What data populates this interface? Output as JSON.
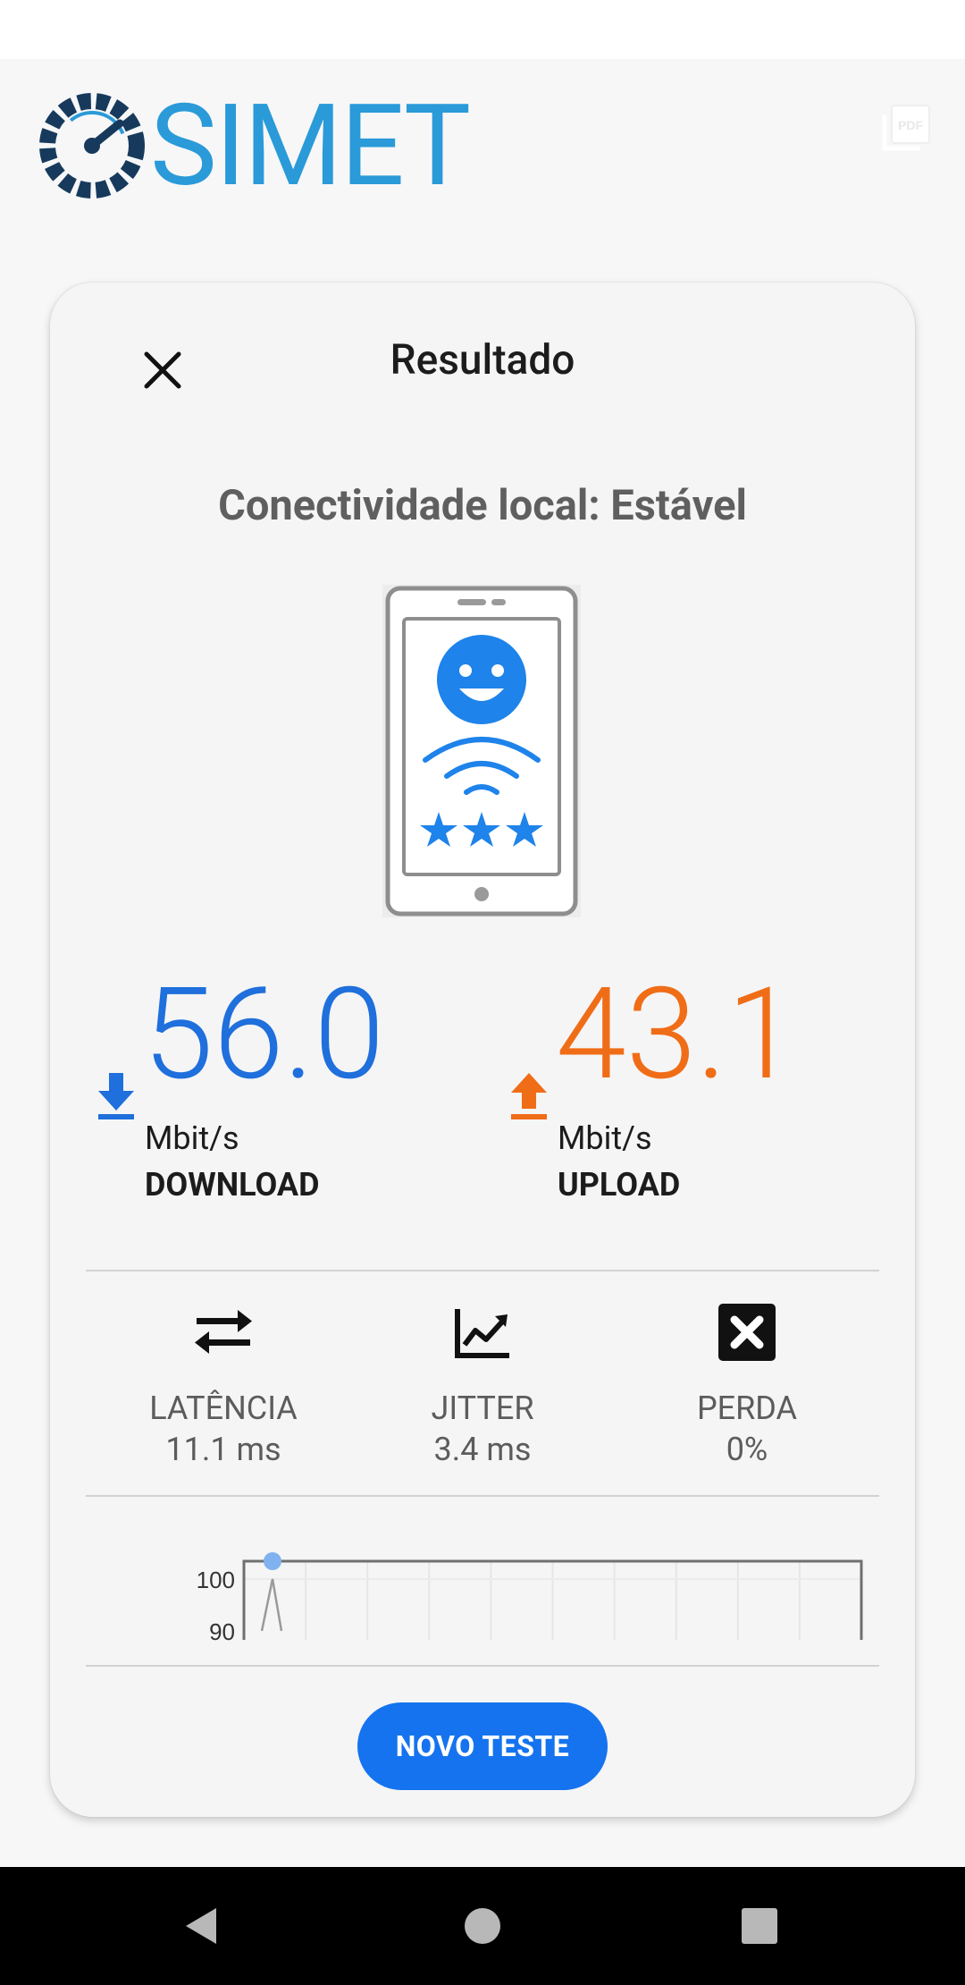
{
  "app": {
    "logo_text": "SIMET",
    "brand_color": "#2a9ad8",
    "accent_color": "#1573ef"
  },
  "header": {
    "pdf_icon": "pdf-export-icon"
  },
  "result": {
    "title": "Resultado",
    "close_icon": "close-icon",
    "status": "Conectividade local: Estável",
    "illustration": "happy-phone-wifi-3-stars",
    "download": {
      "value": "56.0",
      "unit": "Mbit/s",
      "label": "DOWNLOAD",
      "color": "#1f6fdc",
      "icon": "download-arrow-icon"
    },
    "upload": {
      "value": "43.1",
      "unit": "Mbit/s",
      "label": "UPLOAD",
      "color": "#f06d17",
      "icon": "upload-arrow-icon"
    },
    "metrics": [
      {
        "label": "LATÊNCIA",
        "value": "11.1 ms",
        "icon": "swap-arrows-icon"
      },
      {
        "label": "JITTER",
        "value": "3.4 ms",
        "icon": "trend-chart-icon"
      },
      {
        "label": "PERDA",
        "value": "0%",
        "icon": "x-box-icon"
      }
    ],
    "new_test_label": "NOVO TESTE"
  },
  "chart_data": {
    "type": "line",
    "yticks": [
      "100",
      "90"
    ],
    "ylim": [
      90,
      100
    ],
    "grid": true,
    "series": [
      {
        "values": [
          90,
          100,
          90
        ]
      }
    ]
  },
  "nav": {
    "back_icon": "back-triangle-icon",
    "home_icon": "home-circle-icon",
    "recents_icon": "recents-square-icon"
  }
}
